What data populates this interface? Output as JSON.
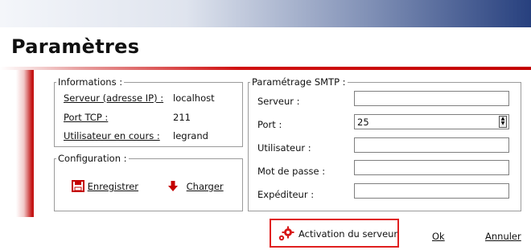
{
  "title": "Paramètres",
  "informations": {
    "legend": "Informations :",
    "rows": [
      {
        "label": "Serveur (adresse IP) :",
        "value": "localhost"
      },
      {
        "label": "Port TCP :",
        "value": "211"
      },
      {
        "label": "Utilisateur en cours :",
        "value": "legrand"
      }
    ]
  },
  "configuration": {
    "legend": "Configuration :",
    "save_label": "Enregistrer",
    "load_label": "Charger"
  },
  "smtp": {
    "legend": "Paramétrage SMTP :",
    "server_label": "Serveur :",
    "server_value": "",
    "port_label": "Port :",
    "port_value": "25",
    "user_label": "Utilisateur :",
    "user_value": "",
    "password_label": "Mot de passe :",
    "password_value": "",
    "sender_label": "Expéditeur :",
    "sender_value": ""
  },
  "buttons": {
    "activation": "Activation du serveur",
    "ok": "Ok",
    "cancel": "Annuler"
  },
  "colors": {
    "accent_red": "#c41717",
    "title_bar_blue": "#27407e",
    "highlight_border": "#e02020"
  },
  "icons": {
    "save": "floppy-disk-icon",
    "load": "down-arrow-icon",
    "activation": "gears-icon"
  }
}
